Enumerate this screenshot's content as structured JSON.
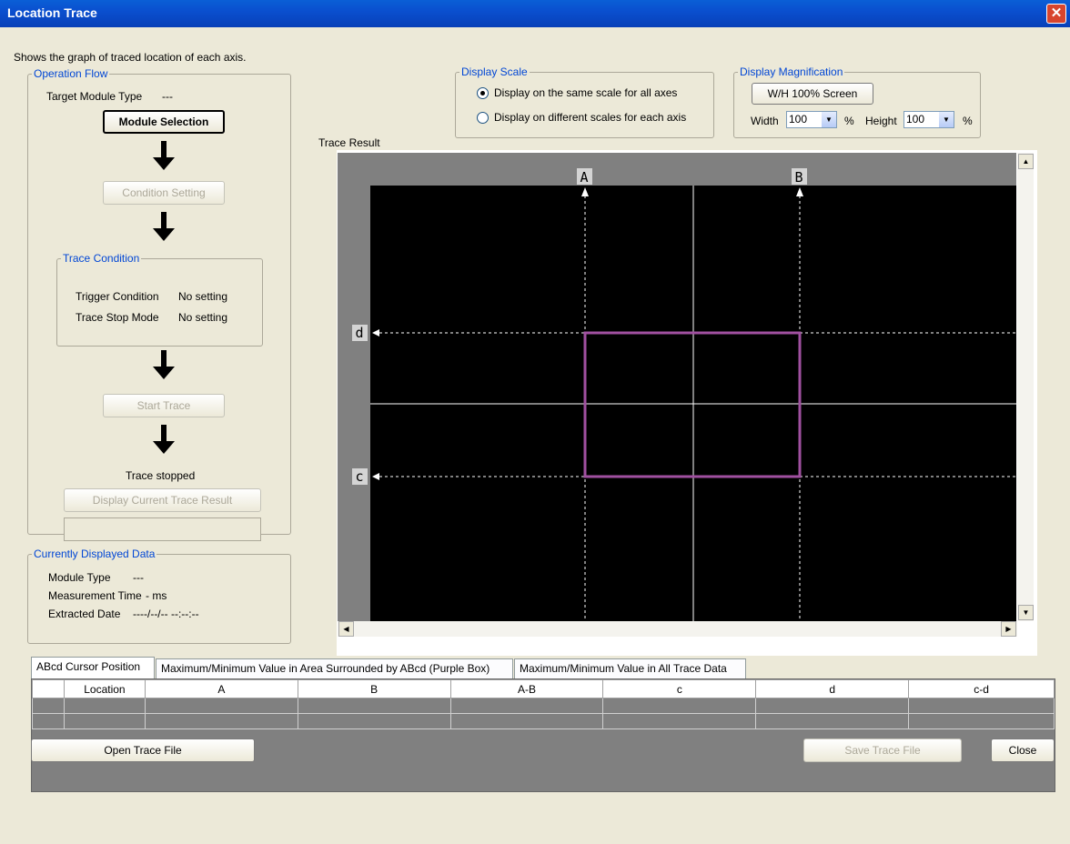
{
  "window": {
    "title": "Location Trace",
    "close_glyph": "✕"
  },
  "description": "Shows the graph of traced location of each axis.",
  "operation_flow": {
    "legend": "Operation Flow",
    "target_module_label": "Target Module Type",
    "target_module_value": "---",
    "module_selection_btn": "Module Selection",
    "condition_setting_btn": "Condition Setting",
    "trace_condition": {
      "legend": "Trace Condition",
      "trigger_label": "Trigger Condition",
      "trigger_value": "No setting",
      "stop_mode_label": "Trace Stop Mode",
      "stop_mode_value": "No setting"
    },
    "start_trace_btn": "Start Trace",
    "status": "Trace stopped",
    "display_current_btn": "Display Current Trace Result"
  },
  "displayed_data": {
    "legend": "Currently Displayed Data",
    "module_type_label": "Module Type",
    "module_type_value": "---",
    "measurement_label": "Measurement Time",
    "measurement_value": "- ms",
    "extracted_label": "Extracted Date",
    "extracted_value": "----/--/-- --:--:--"
  },
  "display_scale": {
    "legend": "Display Scale",
    "option_same": "Display on the same scale for all axes",
    "option_diff": "Display on different scales for each axis",
    "selected": "same"
  },
  "display_magnification": {
    "legend": "Display Magnification",
    "wh_btn": "W/H 100% Screen",
    "width_label": "Width",
    "width_value": "100",
    "height_label": "Height",
    "height_value": "100",
    "unit": "%"
  },
  "trace_result": {
    "label": "Trace Result",
    "cursor_a": "A",
    "cursor_b": "B",
    "cursor_c": "c",
    "cursor_d": "d"
  },
  "tabs": [
    "ABcd Cursor Position",
    "Maximum/Minimum Value in Area Surrounded by ABcd (Purple Box)",
    "Maximum/Minimum Value in All Trace Data"
  ],
  "table": {
    "columns": [
      "",
      "Location",
      "A",
      "B",
      "A-B",
      "c",
      "d",
      "c-d"
    ]
  },
  "footer": {
    "open_btn": "Open Trace File",
    "save_btn": "Save Trace File",
    "close_btn": "Close"
  },
  "colors": {
    "purple_box": "#a050a0",
    "plot_bg": "#000000",
    "plot_margin": "#808080"
  }
}
